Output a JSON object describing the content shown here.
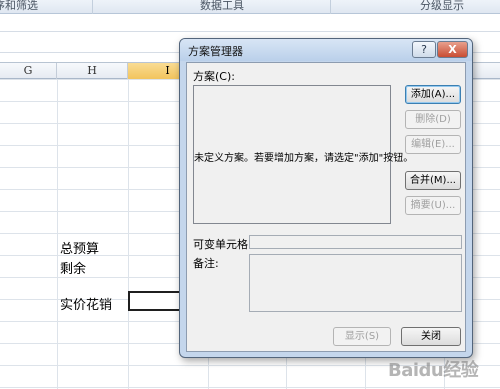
{
  "ribbon": {
    "labels": [
      "序和筛选",
      "数据工具",
      "分级显示"
    ]
  },
  "columns": [
    {
      "label": "G",
      "selected": false
    },
    {
      "label": "H",
      "selected": false
    },
    {
      "label": "I",
      "selected": true
    }
  ],
  "cells": {
    "total_budget": "总预算",
    "remaining": "剩余",
    "actual_spend": "实价花销"
  },
  "dialog": {
    "title": "方案管理器",
    "help_label": "?",
    "close_label": "X",
    "scenarios_label": "方案(C):",
    "empty_message": "未定义方案。若要增加方案，请选定\"添加\"按钮。",
    "buttons": {
      "add": "添加(A)...",
      "delete": "删除(D)",
      "edit": "编辑(E)...",
      "merge": "合并(M)...",
      "summary": "摘要(U)...",
      "show": "显示(S)",
      "close": "关闭"
    },
    "changing_cells_label": "可变单元格:",
    "changing_cells_value": "",
    "comment_label": "备注:",
    "comment_value": ""
  },
  "watermark": {
    "text": "Baidu经验"
  }
}
